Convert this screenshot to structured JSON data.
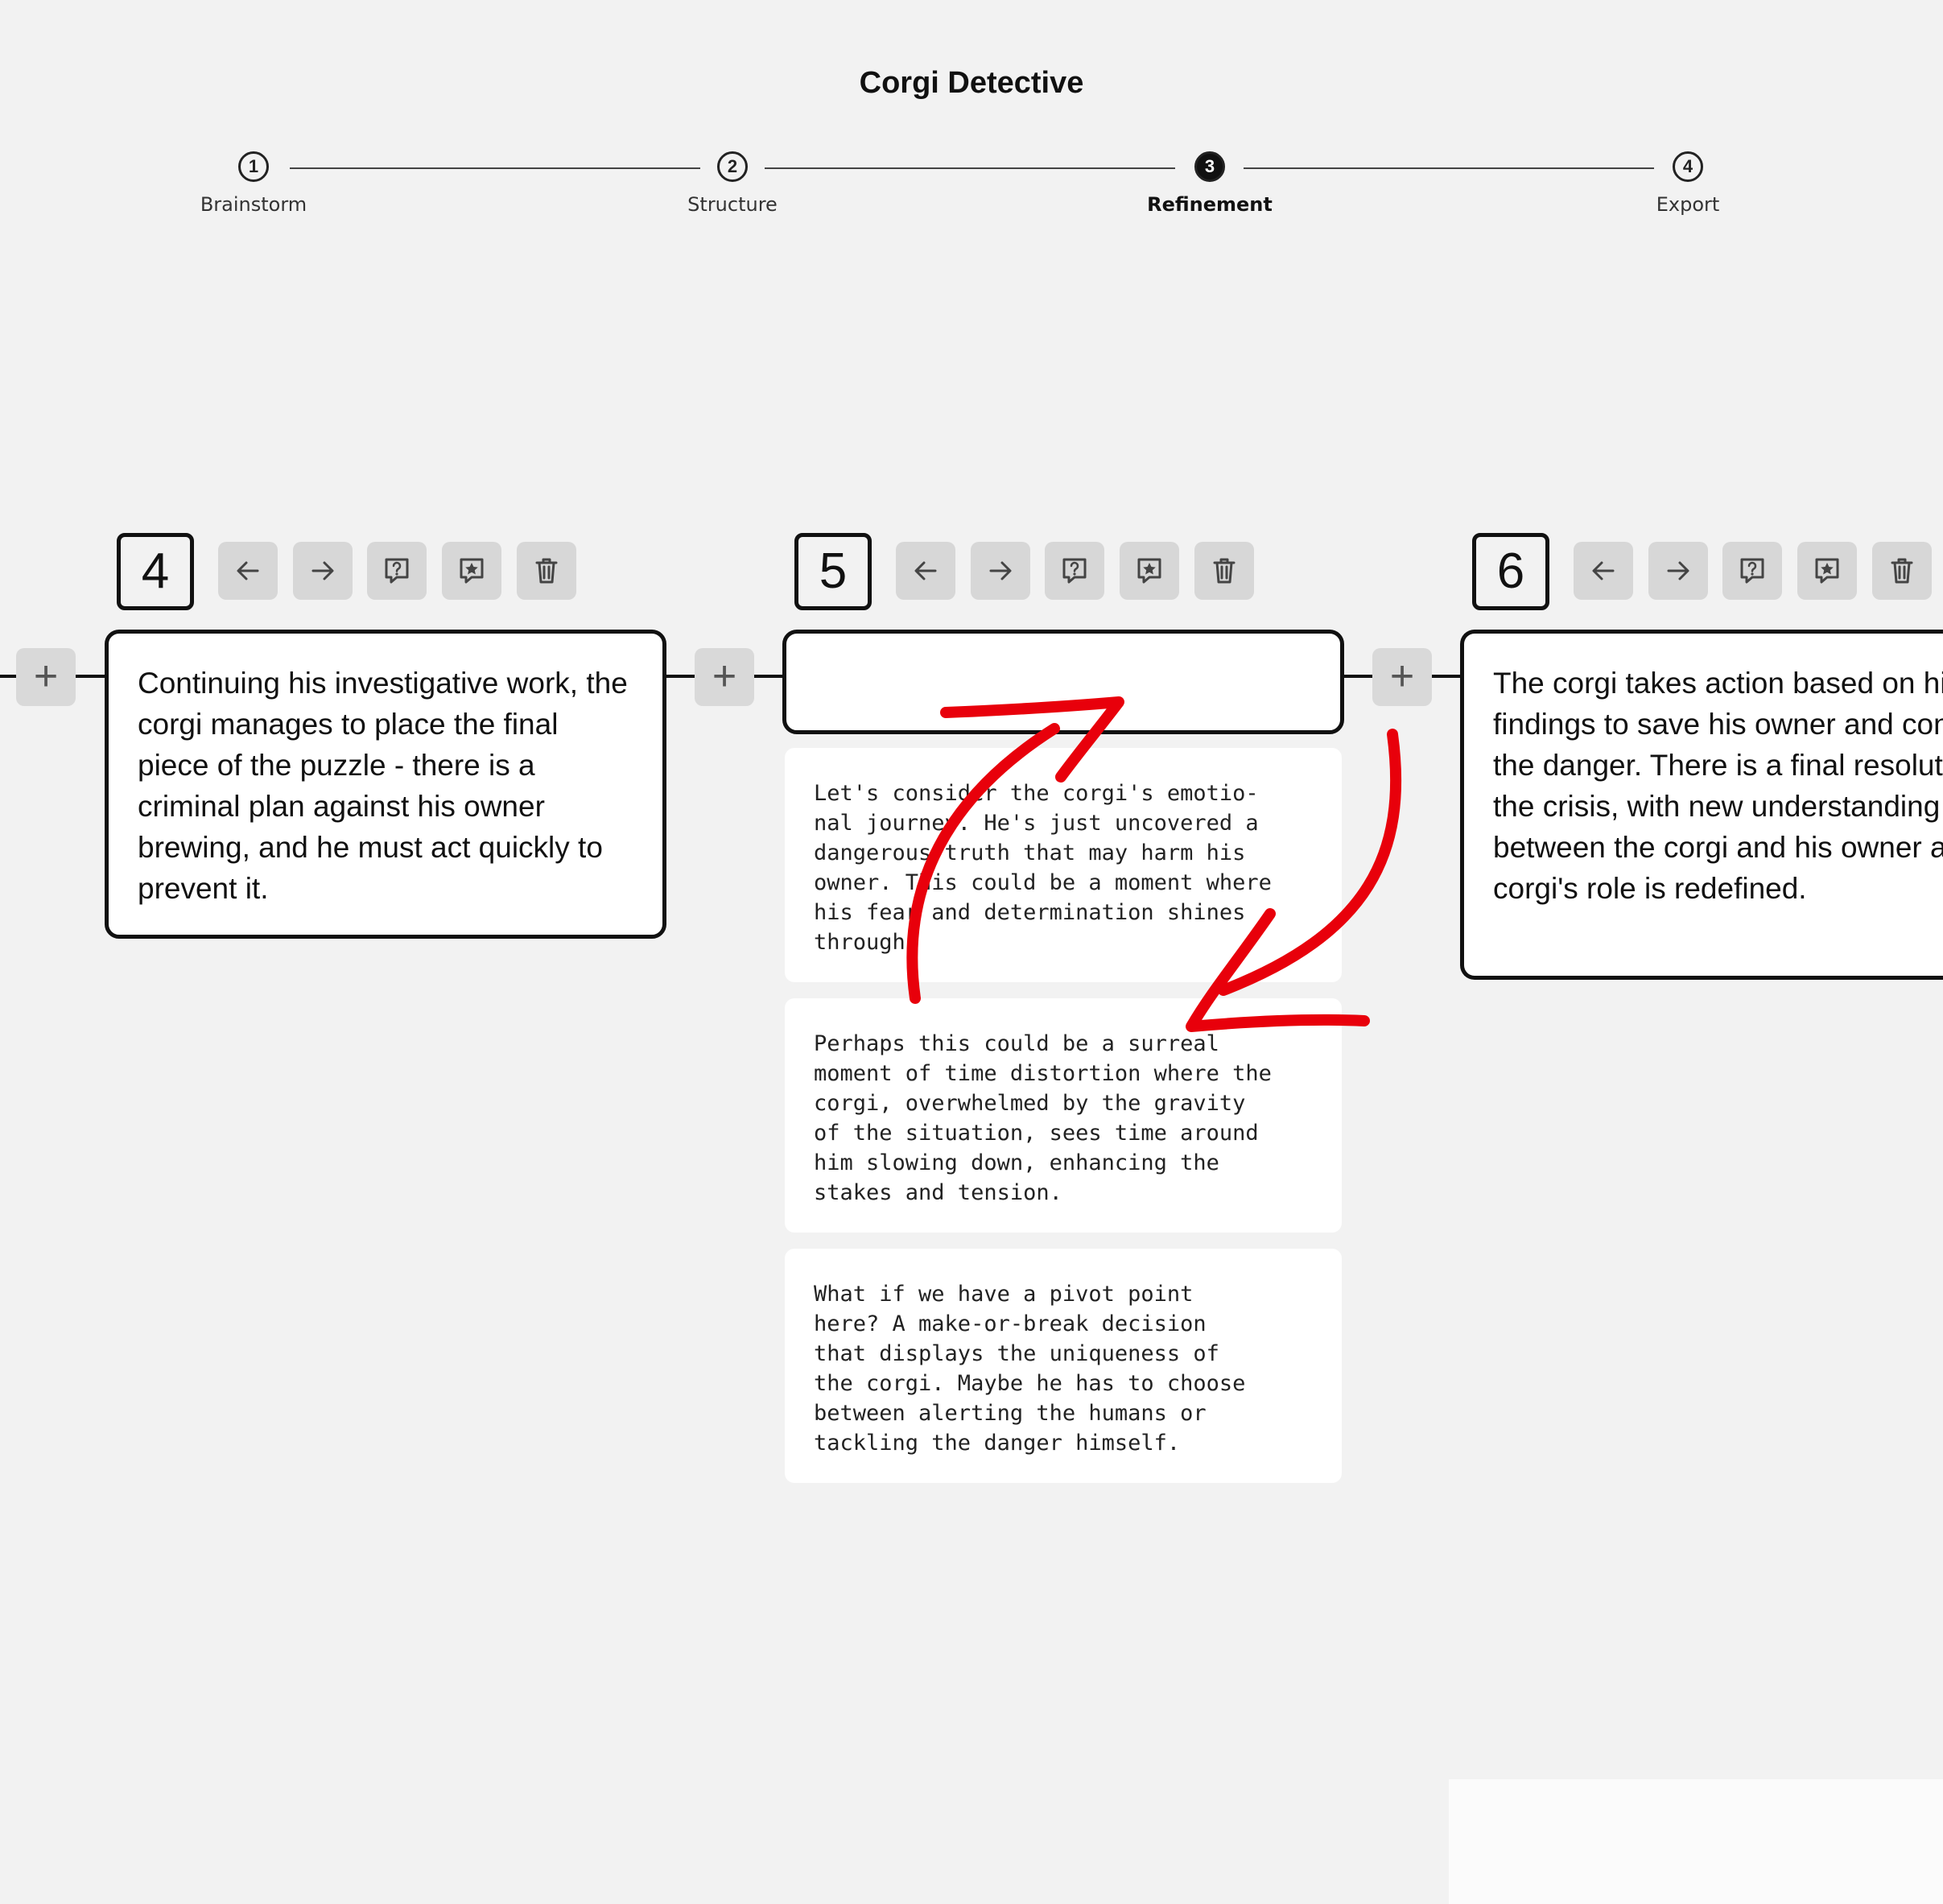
{
  "app": {
    "title": "Corgi Detective"
  },
  "stepper": {
    "steps": [
      {
        "number": "1",
        "label": "Brainstorm",
        "active": false
      },
      {
        "number": "2",
        "label": "Structure",
        "active": false
      },
      {
        "number": "3",
        "label": "Refinement",
        "active": true
      },
      {
        "number": "4",
        "label": "Export",
        "active": false
      }
    ]
  },
  "scenes": [
    {
      "number": "4",
      "text": "Continuing his investigative work, the corgi manages to place the final piece of the puzzle - there is a criminal plan against his owner brewing, and he must act quickly to prevent it."
    },
    {
      "number": "5",
      "text": "",
      "suggestions": [
        "Let's consider the corgi's emotio-\nnal journey. He's just uncovered a\ndangerous truth that may harm his\nowner. This could be a moment where\nhis fear and determination shines\nthrough.",
        "Perhaps this could be a surreal\nmoment of time distortion where the\ncorgi, overwhelmed by the gravity\nof the situation, sees time around\nhim slowing down, enhancing the\nstakes and tension.",
        "What if we have a pivot point\nhere? A make-or-break decision\nthat displays the uniqueness of\nthe corgi. Maybe he has to choose\nbetween alerting the humans or\ntackling the danger himself."
      ]
    },
    {
      "number": "6",
      "text": "The corgi takes action based on his findings to save his owner and confront the danger. There is a final resolution to the crisis, with new understanding between the corgi and his owner and the corgi's role is redefined."
    }
  ],
  "toolbar_icons": [
    "arrow-left-icon",
    "arrow-right-icon",
    "question-bubble-icon",
    "star-bubble-icon",
    "trash-icon"
  ],
  "plus_label": "+",
  "colors": {
    "background": "#f2f2f2",
    "annotation": "#e8000b",
    "button": "#d7d7d7"
  }
}
